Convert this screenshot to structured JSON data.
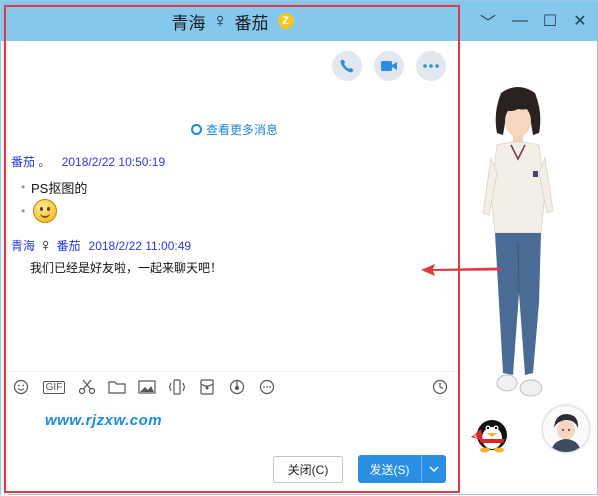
{
  "window": {
    "title_left": "青海",
    "title_right": "番茄",
    "gender_symbol": "♀",
    "vip_badge": "Z",
    "controls": [
      "﹀",
      "—",
      "☐",
      "✕"
    ]
  },
  "chat": {
    "more_history": "查看更多消息",
    "messages": [
      {
        "sender": "番茄 。",
        "time": "2018/2/22 10:50:19",
        "lines": [
          "PS抠图的"
        ]
      },
      {
        "sender_a": "青海",
        "gender": "♀",
        "sender_b": "番茄",
        "time": "2018/2/22 11:00:49",
        "text": "我们已经是好友啦，一起来聊天吧！"
      }
    ]
  },
  "toolbar": {
    "gif_label": "GIF"
  },
  "watermark": "www.rjzxw.com",
  "buttons": {
    "close": "关闭(C)",
    "send": "发送(S)"
  },
  "accent": "#2a8fe3",
  "highlight_box": "#e23a44"
}
